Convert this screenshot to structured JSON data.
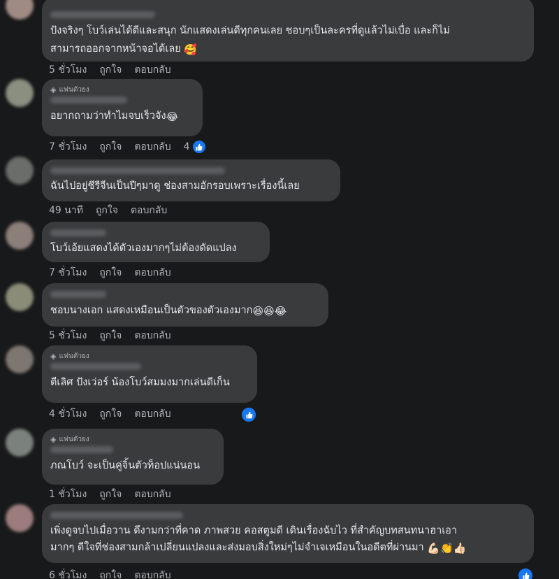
{
  "labels": {
    "like": "ถูกใจ",
    "reply": "ตอบกลับ",
    "badge": "แฟนตัวยง"
  },
  "comments": [
    {
      "text": "ปังจริงๆ โบว์เล่นได้ดีและสนุก นักแสดงเล่นดีทุกคนเลย ชอบๆเป็นละครที่ดูแล้วไม่เบื่อ และก็ไม่\nสามารถออกจากหน้าจอได้เลย",
      "emoji": "smiling-face-with-hearts",
      "time": "5 ชั่วโมง"
    },
    {
      "text": "อยากถามว่าทำไมจบเร็วจัง",
      "emoji": "laughing-face",
      "time": "7 ชั่วโมง",
      "likes": "4"
    },
    {
      "text": "ฉันไปอยู่ชีรีจีนเป็นปีๆมาดู ช่องสามอักรอบเพราะเรื่องนี้เลย",
      "time": "49 นาที"
    },
    {
      "text": "โบว์เอ้ยแสดงได้ตัวเองมากๆไม่ต้องดัดแปลง",
      "time": "7 ชั่วโมง"
    },
    {
      "text": "ชอบนางเอก แสดงเหมือนเป็นตัวของตัวเองมาก",
      "emoji": "laughing-faces-x3",
      "time": "5 ชั่วโมง"
    },
    {
      "text": "ตีเลิศ ปังเว่อร์ น้องโบว์สมมงมากเล่นดีเก็น",
      "time": "4 ชั่วโมง"
    },
    {
      "text": "ภณโบว์ จะเป็นคู่จิ้นตัวท็อปแน่นอน",
      "time": "1 ชั่วโมง"
    },
    {
      "text": "เพิ่งดูจบไปเมื่อวาน ดึงามกว่าที่คาด ภาพสวย คอสตูมดี เดินเรื่องฉับไว ที่สำคัญบทสนทนาฮาเอา\nมากๆ ดีใจที่ช่องสามกล้าเปลี่ยนแปลงและส่งมอบสิ่งใหม่ๆไม่จำเจเหมือนในอดีตที่ผ่านมา",
      "emoji": "muscle-clap-thumbsup",
      "time": "6 ชั่วโมง"
    }
  ],
  "colors": {
    "background": "#18191a",
    "bubble": "#3a3b3c",
    "text": "#e4e6eb",
    "muted": "#b0b3b8",
    "like_blue": "#1877f2"
  }
}
